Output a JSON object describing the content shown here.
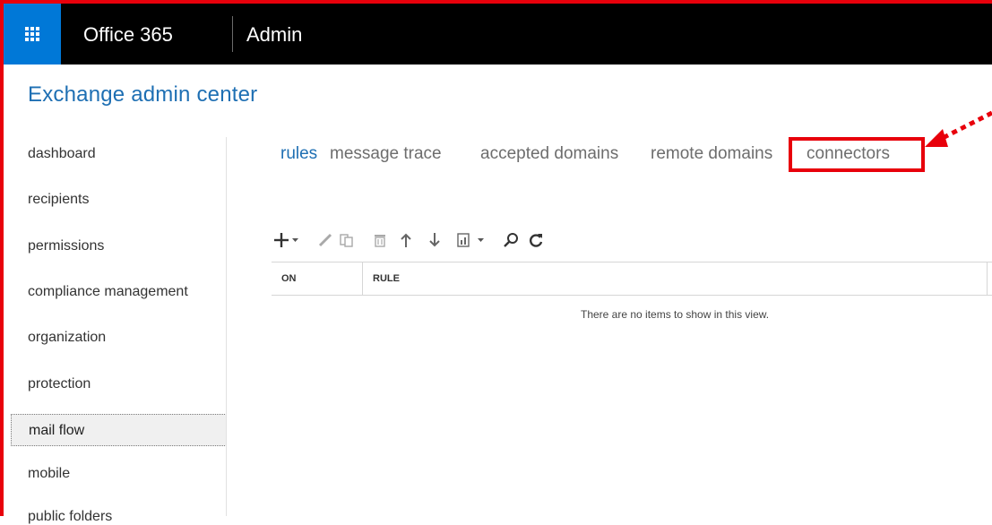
{
  "topbar": {
    "product": "Office 365",
    "section": "Admin",
    "brand_color": "#0078d7"
  },
  "app_title": "Exchange admin center",
  "nav": {
    "items": [
      {
        "label": "dashboard"
      },
      {
        "label": "recipients"
      },
      {
        "label": "permissions"
      },
      {
        "label": "compliance management"
      },
      {
        "label": "organization"
      },
      {
        "label": "protection"
      },
      {
        "label": "mail flow",
        "selected": true
      },
      {
        "label": "mobile"
      },
      {
        "label": "public folders"
      }
    ]
  },
  "tabs": [
    {
      "label": "rules",
      "active": true
    },
    {
      "label": "message trace"
    },
    {
      "label": "accepted domains"
    },
    {
      "label": "remote domains"
    },
    {
      "label": "connectors",
      "highlighted": true
    }
  ],
  "toolbar": {
    "icons": [
      "add-icon",
      "edit-icon",
      "copy-icon",
      "delete-icon",
      "move-up-icon",
      "move-down-icon",
      "report-icon",
      "search-icon",
      "refresh-icon"
    ]
  },
  "table": {
    "columns": [
      "ON",
      "RULE"
    ],
    "empty_message": "There are no items to show in this view."
  },
  "annotation": {
    "color": "#e8000b"
  }
}
